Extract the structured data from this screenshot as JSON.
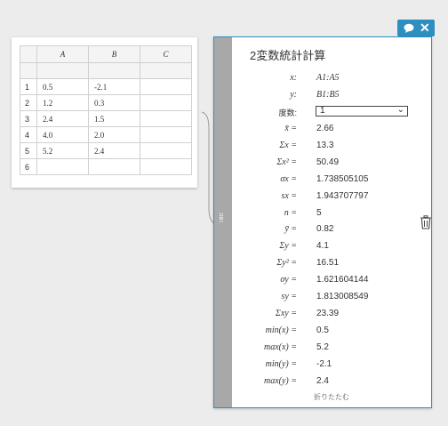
{
  "sheet": {
    "columns": [
      "A",
      "B",
      "C"
    ],
    "rows": [
      {
        "num": "1",
        "a": "0.5",
        "b": "-2.1",
        "c": ""
      },
      {
        "num": "2",
        "a": "1.2",
        "b": "0.3",
        "c": ""
      },
      {
        "num": "3",
        "a": "2.4",
        "b": "1.5",
        "c": ""
      },
      {
        "num": "4",
        "a": "4.0",
        "b": "2.0",
        "c": ""
      },
      {
        "num": "5",
        "a": "5.2",
        "b": "2.4",
        "c": ""
      },
      {
        "num": "6",
        "a": "",
        "b": "",
        "c": ""
      }
    ]
  },
  "panel": {
    "title": "2変数統計計算",
    "collapse_label": "折りたたむ",
    "freq_label": "度数:",
    "freq_value": "1",
    "rows": [
      {
        "label": "x:",
        "value": "A1:A5"
      },
      {
        "label": "y:",
        "value": "B1:B5"
      },
      {
        "label": "x̄ =",
        "value": "2.66"
      },
      {
        "label": "Σx =",
        "value": "13.3"
      },
      {
        "label": "Σx² =",
        "value": "50.49"
      },
      {
        "label": "σx =",
        "value": "1.738505105"
      },
      {
        "label": "sx =",
        "value": "1.943707797"
      },
      {
        "label": "n =",
        "value": "5"
      },
      {
        "label": "ȳ =",
        "value": "0.82"
      },
      {
        "label": "Σy =",
        "value": "4.1"
      },
      {
        "label": "Σy² =",
        "value": "16.51"
      },
      {
        "label": "σy =",
        "value": "1.621604144"
      },
      {
        "label": "sy =",
        "value": "1.813008549"
      },
      {
        "label": "Σxy =",
        "value": "23.39"
      },
      {
        "label": "min(x) =",
        "value": "0.5"
      },
      {
        "label": "max(x) =",
        "value": "5.2"
      },
      {
        "label": "min(y) =",
        "value": "-2.1"
      },
      {
        "label": "max(y) =",
        "value": "2.4"
      }
    ]
  },
  "icons": {
    "toolbar_bubble": "speech-bubble-icon",
    "toolbar_close": "close-icon",
    "trash": "trash-icon",
    "grip": "drag-handle-icon"
  },
  "colors": {
    "accent": "#2d8fbf",
    "grip": "#a8a8a8"
  }
}
